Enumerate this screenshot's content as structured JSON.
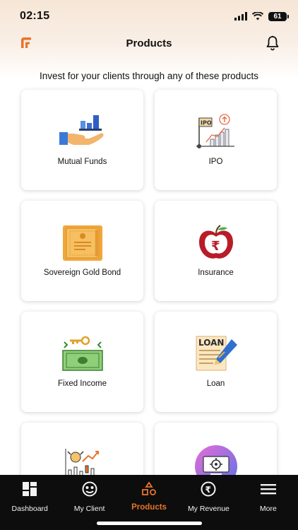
{
  "status_bar": {
    "time": "02:15",
    "battery": "61"
  },
  "header": {
    "title": "Products"
  },
  "subtitle": "Invest for your clients through any of these products",
  "products": [
    {
      "label": "Mutual Funds",
      "icon": "hand-bar-chart-icon"
    },
    {
      "label": "IPO",
      "icon": "ipo-flag-chart-icon"
    },
    {
      "label": "Sovereign Gold Bond",
      "icon": "gold-bond-certificate-icon"
    },
    {
      "label": "Insurance",
      "icon": "apple-rupee-icon"
    },
    {
      "label": "Fixed Income",
      "icon": "money-key-icon"
    },
    {
      "label": "Loan",
      "icon": "loan-document-pen-icon"
    },
    {
      "label": "",
      "icon": "stock-bull-candlestick-icon"
    },
    {
      "label": "",
      "icon": "gear-screen-circle-icon"
    }
  ],
  "tabbar": {
    "items": [
      {
        "label": "Dashboard",
        "icon": "dashboard-grid-icon",
        "active": false
      },
      {
        "label": "My Client",
        "icon": "client-face-icon",
        "active": false
      },
      {
        "label": "Products",
        "icon": "products-shapes-icon",
        "active": true
      },
      {
        "label": "My Revenue",
        "icon": "rupee-circle-icon",
        "active": false
      },
      {
        "label": "More",
        "icon": "hamburger-menu-icon",
        "active": false
      }
    ]
  },
  "colors": {
    "accent": "#e8742b",
    "tabbar_bg": "#0d0d0d",
    "header_bg": "#f6e6d6"
  }
}
